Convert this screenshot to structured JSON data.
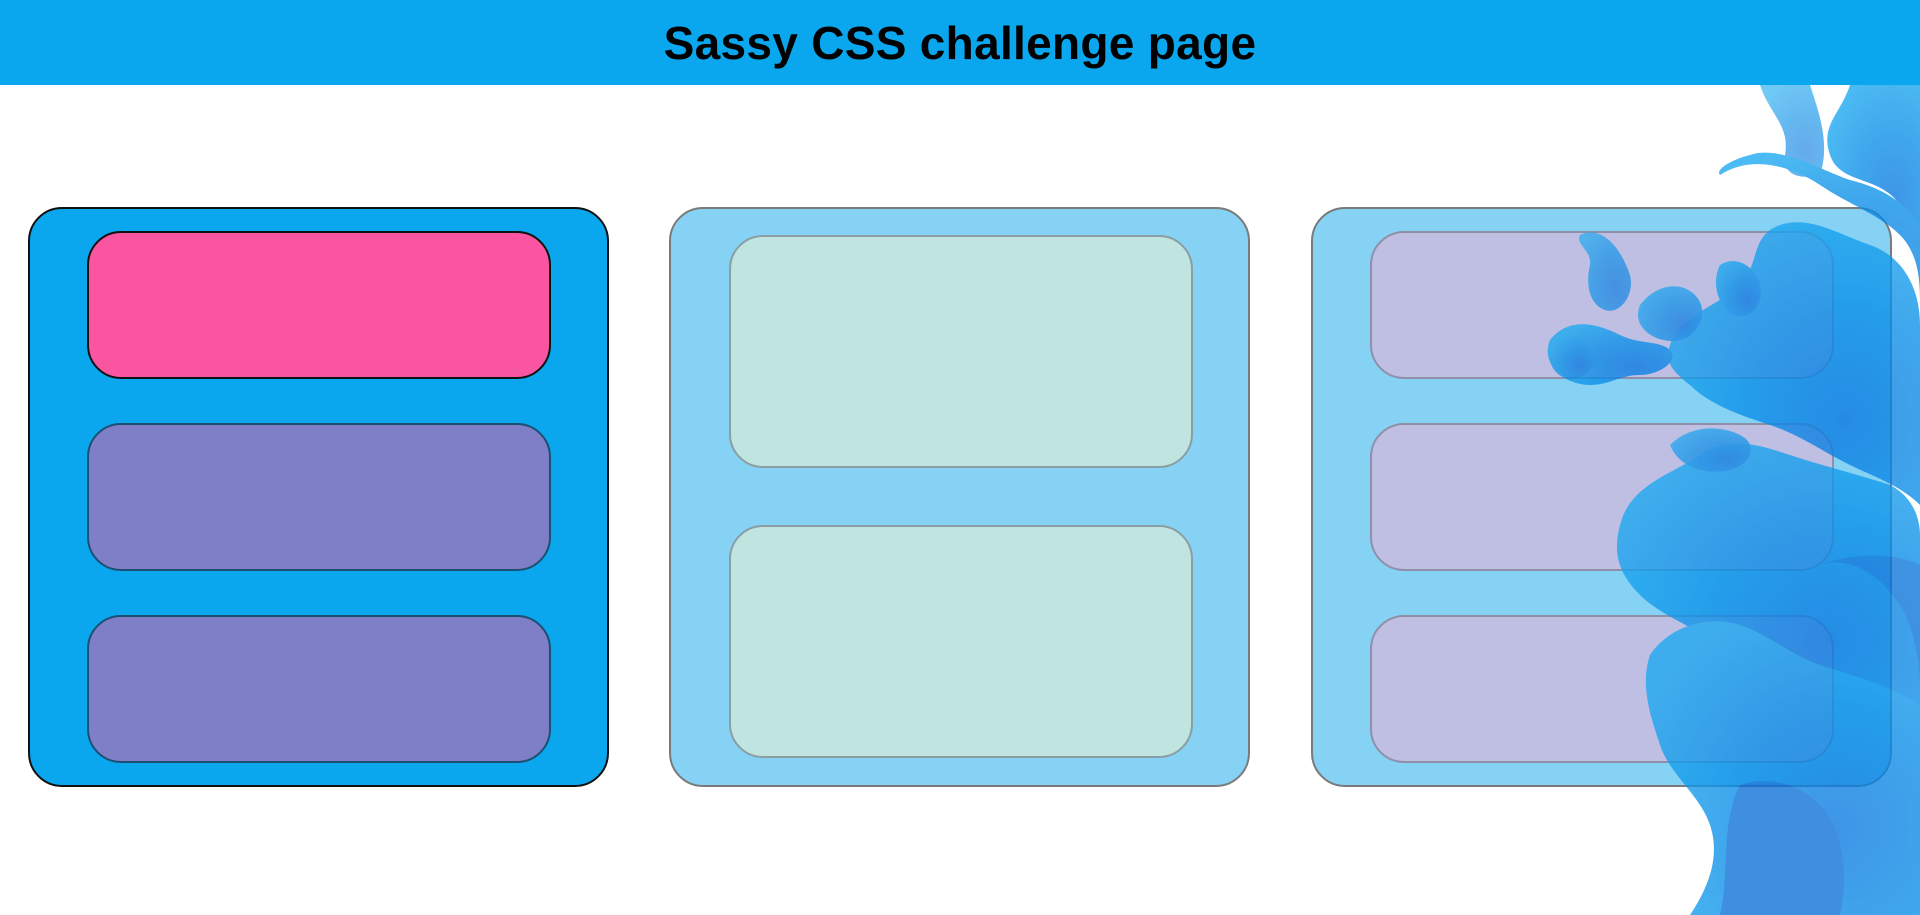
{
  "header": {
    "title": "Sassy CSS challenge page",
    "background_color": "#0aa7ee"
  },
  "decoration": {
    "icon": "blue-ink-splash-image"
  },
  "colors": {
    "card_primary": "#0aa7ee",
    "card_light": "#86d2f5",
    "pink_box": "#f955a0",
    "purple_box": "#7f7fc8",
    "mint_box": "#c0e4df",
    "lavender_box": "#bfbfe3"
  }
}
